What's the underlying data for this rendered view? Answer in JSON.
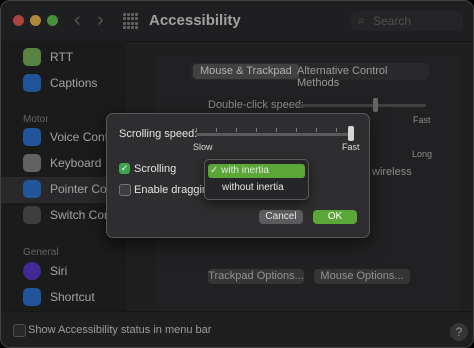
{
  "window": {
    "title": "Accessibility",
    "search_placeholder": "Search"
  },
  "sidebar": {
    "items": [
      {
        "label": "RTT",
        "icon": "rtt-icon",
        "color": "#7ab55c"
      },
      {
        "label": "Captions",
        "icon": "captions-icon",
        "color": "#2f76d4"
      },
      {
        "label": "Voice Control",
        "icon": "voice-control-icon",
        "color": "#2f76d4"
      },
      {
        "label": "Keyboard",
        "icon": "keyboard-icon",
        "color": "#8a8a8c"
      },
      {
        "label": "Pointer Control",
        "icon": "pointer-control-icon",
        "color": "#2f76d4"
      },
      {
        "label": "Switch Control",
        "icon": "switch-control-icon",
        "color": "#555557"
      },
      {
        "label": "Siri",
        "icon": "siri-icon",
        "color": "#5a3bd0"
      },
      {
        "label": "Shortcut",
        "icon": "shortcut-icon",
        "color": "#2f76d4"
      }
    ],
    "sections": {
      "motor": "Motor",
      "general": "General"
    }
  },
  "panel": {
    "tabs": [
      "Mouse & Trackpad",
      "Alternative Control Methods"
    ],
    "double_click_label": "Double-click speed:",
    "fast": "Fast",
    "long": "Long",
    "wireless": "wireless",
    "trackpad_options": "Trackpad Options...",
    "mouse_options": "Mouse Options..."
  },
  "bottom": {
    "show_status": "Show Accessibility status in menu bar",
    "help": "?"
  },
  "sheet": {
    "scrolling_speed_label": "Scrolling speed:",
    "slow": "Slow",
    "fast": "Fast",
    "speed_value": 1.0,
    "scrolling_label": "Scrolling",
    "scrolling_checked": true,
    "enable_dragging_label": "Enable dragging",
    "enable_dragging_checked": false,
    "menu_options": [
      "with inertia",
      "without inertia"
    ],
    "selected_check": "✓",
    "cancel": "Cancel",
    "ok": "OK"
  },
  "colors": {
    "accent": "#5aa737"
  }
}
